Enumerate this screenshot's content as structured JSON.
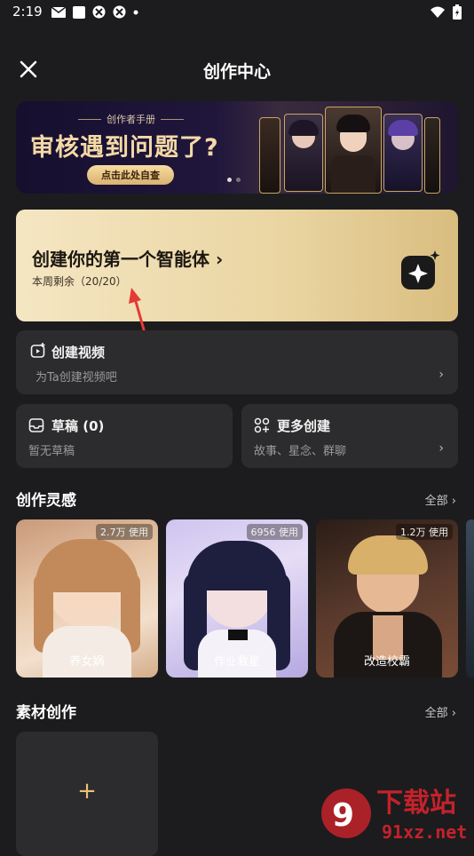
{
  "status": {
    "time": "2:19"
  },
  "header": {
    "title": "创作中心"
  },
  "banner": {
    "subtitle": "创作者手册",
    "headline": "审核遇到问题了?",
    "button": "点击此处自查"
  },
  "agent": {
    "title": "创建你的第一个智能体 ›",
    "remaining": "本周剩余（20/20）",
    "accent": "#ead5a2"
  },
  "video": {
    "title": "创建视频",
    "subtitle": "为Ta创建视频吧"
  },
  "drafts": {
    "title": "草稿 (0)",
    "subtitle": "暂无草稿"
  },
  "more": {
    "title": "更多创建",
    "subtitle": "故事、星念、群聊"
  },
  "inspiration": {
    "title": "创作灵感",
    "all": "全部 ›",
    "items": [
      {
        "badge": "2.7万 使用",
        "label": "养女娲"
      },
      {
        "badge": "6956 使用",
        "label": "作业救星"
      },
      {
        "badge": "1.2万 使用",
        "label": "改造校霸"
      }
    ]
  },
  "material": {
    "title": "素材创作",
    "all": "全部 ›",
    "add": "+"
  },
  "watermark": {
    "text": "下载站",
    "url": "91xz.net"
  }
}
